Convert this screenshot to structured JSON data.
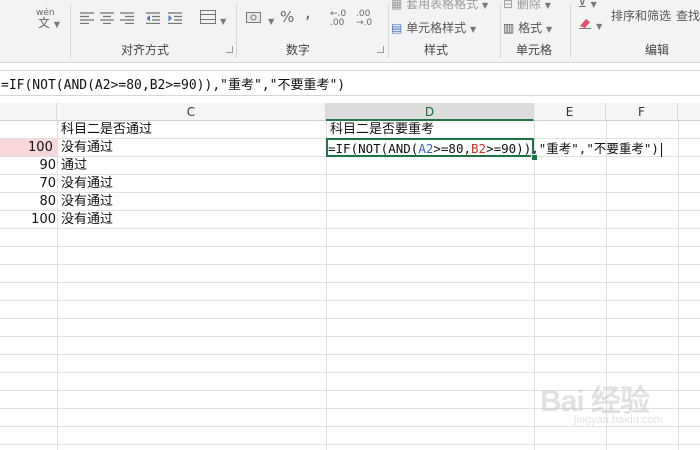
{
  "ribbon": {
    "wen_label": "wén",
    "wen_char": "文",
    "groups": {
      "alignment": "对齐方式",
      "number": "数字",
      "styles": "样式",
      "cells": "单元格",
      "editing": "编辑"
    },
    "number": {
      "percent": "%",
      "comma": ",",
      "inc_decimal": "←.0\n.00",
      "dec_decimal": ".00\n→.0"
    },
    "styles": {
      "table_format": "套用表格格式",
      "cell_styles": "单元格样式"
    },
    "cells": {
      "delete": "删除",
      "format": "格式"
    },
    "editing": {
      "sort_filter": "排序和筛选",
      "find": "查找"
    }
  },
  "formula_bar": {
    "text": "=IF(NOT(AND(A2>=80,B2>=90)),\"重考\",\"不要重考\")"
  },
  "columns": {
    "c": "C",
    "d": "D",
    "e": "E",
    "f": "F"
  },
  "sheet": {
    "header_c": "科目二是否通过",
    "header_d": "科目二是否要重考",
    "rows": [
      {
        "num": "100",
        "c": "没有通过"
      },
      {
        "num": "90",
        "c": "通过"
      },
      {
        "num": "70",
        "c": "没有通过"
      },
      {
        "num": "80",
        "c": "没有通过"
      },
      {
        "num": "100",
        "c": "没有通过"
      }
    ],
    "edit": {
      "p1": "=IF(NOT(AND(",
      "ref_a": "A2",
      "p2": ">=80,",
      "ref_b": "B2",
      "p3": ">=90)),\"重考\",\"不要重考\")"
    }
  },
  "watermark": {
    "logo": "Bai 经验",
    "sub": "jingyan.baidu.com"
  },
  "colors": {
    "accent": "#217346",
    "ref_a": "#3b63c4",
    "ref_b": "#c0392b",
    "highlight": "#f7d7d9"
  }
}
